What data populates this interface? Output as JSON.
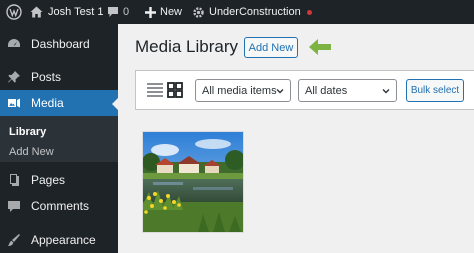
{
  "admin_bar": {
    "site_name": "Josh Test 1",
    "comments_count": "0",
    "new_label": "New",
    "plugin_label": "UnderConstruction",
    "icons": [
      "wordpress-logo-icon",
      "home-icon",
      "comment-icon",
      "plus-icon",
      "gear-icon"
    ],
    "status_dot_color": "#d63638"
  },
  "sidebar": {
    "items": [
      {
        "label": "Dashboard",
        "icon": "dashboard-icon"
      },
      {
        "label": "Posts",
        "icon": "pin-icon"
      },
      {
        "label": "Media",
        "icon": "media-icon",
        "current": true
      },
      {
        "label": "Pages",
        "icon": "pages-icon"
      },
      {
        "label": "Comments",
        "icon": "comment-icon"
      },
      {
        "label": "Appearance",
        "icon": "paintbrush-icon"
      }
    ],
    "submenu": [
      {
        "label": "Library",
        "active": true
      },
      {
        "label": "Add New"
      }
    ],
    "accent": "#2271b1"
  },
  "main": {
    "title": "Media Library",
    "add_new_label": "Add New",
    "toolbar": {
      "media_type_selected": "All media items",
      "date_selected": "All dates",
      "bulk_select_label": "Bulk select",
      "view_modes": [
        "list-view-icon",
        "grid-view-icon"
      ]
    },
    "attachments": [
      {
        "kind": "image",
        "subject": "village-pond-thumbnail"
      }
    ],
    "callout_arrow_color": "#7cb342"
  }
}
